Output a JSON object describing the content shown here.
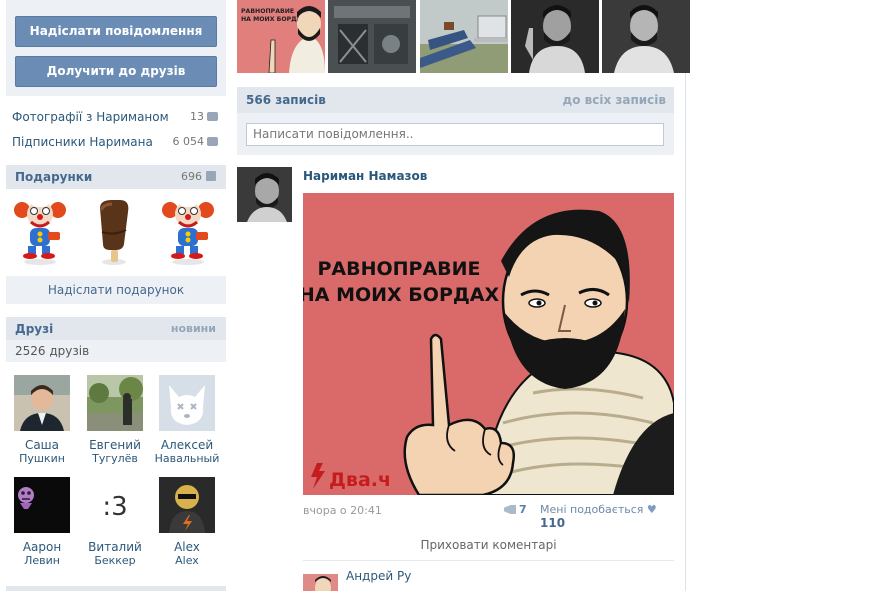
{
  "actions": {
    "send_message": "Надіслати повідомлення",
    "add_friend": "Долучити до друзів"
  },
  "stats": [
    {
      "label": "Фотографії з Нариманом",
      "count": "13"
    },
    {
      "label": "Підписники Наримана",
      "count": "6 054"
    }
  ],
  "gifts": {
    "title": "Подарунки",
    "count": "696",
    "send_label": "Надіслати подарунок"
  },
  "friends": {
    "title": "Друзі",
    "new_link": "новини",
    "count_text": "2526 друзів",
    "list": [
      {
        "first": "Саша",
        "last": "Пушкин"
      },
      {
        "first": "Евгений",
        "last": "Тугулёв"
      },
      {
        "first": "Алексей",
        "last": "Навальный"
      },
      {
        "first": "Аарон",
        "last": "Левин"
      },
      {
        "first": "Виталий",
        "last": "Беккер"
      },
      {
        "first": "Alex",
        "last": "Alex"
      }
    ]
  },
  "wall": {
    "count": "566 записів",
    "all_link": "до всіх записів",
    "composer_placeholder": "Написати повідомлення.."
  },
  "post": {
    "author": "Нариман Намазов",
    "image_caption_line1": "РАВНОПРАВИЕ",
    "image_caption_line2": "НА МОИХ БОРДАХ",
    "image_brand": "Два.ч",
    "time": "вчора о 20:41",
    "shares": "7",
    "likes_label": "Мені подобається",
    "likes": "110",
    "hide_comments": "Приховати коментарі"
  },
  "comment": {
    "author": "Андрей Ру"
  },
  "thumb_caption_line1": "РАВНОПРАВИЕ",
  "thumb_caption_line2": "НА МОИХ БОРДАХ"
}
